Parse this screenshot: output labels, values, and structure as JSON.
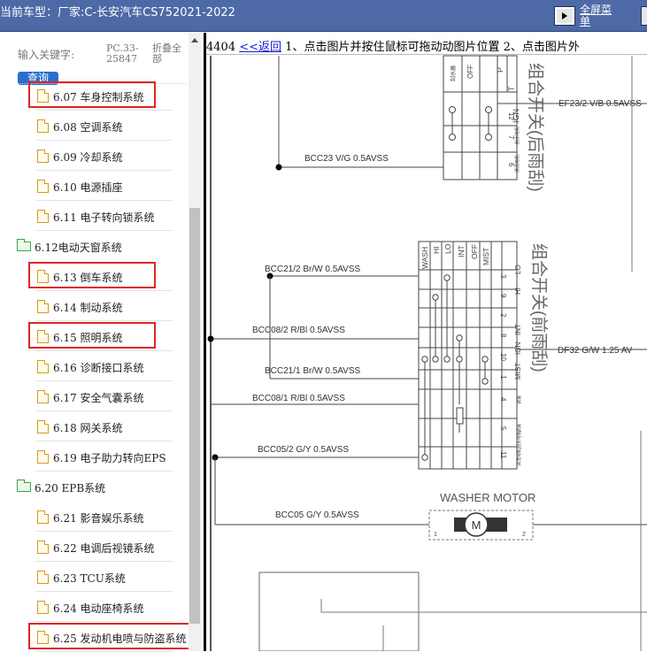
{
  "header": {
    "car_info": "当前车型：厂家:C-长安汽车CS752021-2022",
    "fullscreen_link": "全屏菜单"
  },
  "sidebar": {
    "keyword_label": "输入关键字:",
    "keyword_value": "PC.33-25847",
    "collapse_all": "折叠全部",
    "query_button": "查询",
    "items": [
      {
        "label": "6.07 车身控制系统",
        "type": "file",
        "highlighted": true
      },
      {
        "label": "6.08 空调系统",
        "type": "file",
        "highlighted": false
      },
      {
        "label": "6.09 冷却系统",
        "type": "file",
        "highlighted": false
      },
      {
        "label": "6.10 电源插座",
        "type": "file",
        "highlighted": false
      },
      {
        "label": "6.11 电子转向锁系统",
        "type": "file",
        "highlighted": false
      },
      {
        "label": "6.12电动天窗系统",
        "type": "folder",
        "highlighted": false
      },
      {
        "label": "6.13 倒车系统",
        "type": "file",
        "highlighted": true
      },
      {
        "label": "6.14 制动系统",
        "type": "file",
        "highlighted": false
      },
      {
        "label": "6.15 照明系统",
        "type": "file",
        "highlighted": true
      },
      {
        "label": "6.16 诊断接口系统",
        "type": "file",
        "highlighted": false
      },
      {
        "label": "6.17 安全气囊系统",
        "type": "file",
        "highlighted": false
      },
      {
        "label": "6.18 网关系统",
        "type": "file",
        "highlighted": false
      },
      {
        "label": "6.19 电子助力转向EPS",
        "type": "file",
        "highlighted": false
      },
      {
        "label": "6.20 EPB系统",
        "type": "folder",
        "highlighted": false
      },
      {
        "label": "6.21 影音娱乐系统",
        "type": "file",
        "highlighted": false
      },
      {
        "label": "6.22 电调后视镜系统",
        "type": "file",
        "highlighted": false
      },
      {
        "label": "6.23 TCU系统",
        "type": "file",
        "highlighted": false
      },
      {
        "label": "6.24 电动座椅系统",
        "type": "file",
        "highlighted": false
      },
      {
        "label": "6.25 发动机电喷与防盗系统",
        "type": "file",
        "highlighted": true
      }
    ]
  },
  "content": {
    "page_id": "4404",
    "back_link": "<<返回",
    "instructions": "1、点击图片并按住鼠标可拖动动图片位置 2、点击图片外",
    "diagram": {
      "rear_switch_title": "组合开关(后雨刮)",
      "rear_switch_cols": [
        "刮水器",
        "OFF",
        "P",
        "T"
      ],
      "rear_switch_pins": [
        "IGN",
        "12",
        "7",
        "6"
      ],
      "rear_switch_pin_notes": [
        "刮水电机",
        "清洗电机"
      ],
      "ef23_wire": "EF23/2 V/B  0.5AVSS",
      "bcc23_wire": "BCC23 V/G 0.5AVSS",
      "front_switch_title": "组合开关(前雨刮)",
      "front_switch_cols": [
        "WASH",
        "HI",
        "LO",
        "INT",
        "OFF",
        "MIST"
      ],
      "front_switch_pins": [
        "3",
        "9",
        "2",
        "8",
        "10",
        "1",
        "4",
        "5",
        "11"
      ],
      "front_switch_pin_labels": [
        "LO",
        "HI",
        "INT",
        "IGN",
        "MIST"
      ],
      "front_switch_pin_notes": [
        "调速",
        "调速",
        "刮水电机",
        "清洗电机"
      ],
      "df32_wire": "DF32 G/W 1.25 AV",
      "wires": [
        "BCC21/2 Br/W 0.5AVSS",
        "BCC08/2 R/Bl 0.5AVSS",
        "BCC21/1 Br/W 0.5AVSS",
        "BCC08/1 R/Bl 0.5AVSS",
        "BCC05/2 G/Y 0.5AVSS",
        "BCC05 G/Y 0.5AVSS"
      ],
      "washer_motor": "WASHER MOTOR",
      "motor_symbol": "M",
      "motor_pins": [
        "1",
        "2"
      ]
    }
  }
}
